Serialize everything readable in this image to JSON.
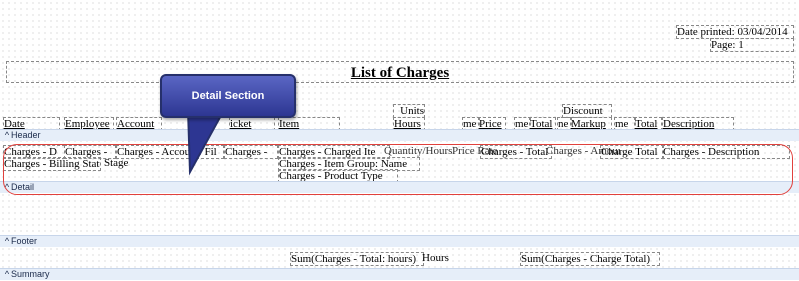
{
  "page_header": {
    "date_printed": "Date printed: 03/04/2014",
    "page": "Page: 1"
  },
  "report_title": "List of Charges",
  "column_headers": {
    "date": "Date",
    "employee": "Employee",
    "account": "Account",
    "ticket": "icket",
    "item": "Item",
    "units_top": "Units",
    "units_hours": "Hours",
    "price_prefix": "me",
    "price": "Price",
    "total_prefix": "me",
    "total": "Total",
    "discount_top": "Discount",
    "markup_prefix": "ne",
    "markup": "Markup",
    "charge_total_prefix": "me",
    "charge_total": "Total",
    "description": "Description"
  },
  "bands": {
    "header": "Header",
    "detail": "Detail",
    "footer": "Footer",
    "summary": "Summary"
  },
  "detail_fields": {
    "date": "Charges - D",
    "employee": "Charges - ",
    "account": "Charges - Account: Fil",
    "ticket": "Charges - ",
    "item_id": "Charges - Charged Ite",
    "quantity_overlap": "Quantity/Hours",
    "price_overlap": "Price Rate",
    "total": "Charges - Total",
    "discount_overlap": "Charges - Amount",
    "charge_total": "Charge Total",
    "description": "Charges - Description",
    "billing_status": "Charges - Billing Status",
    "stage": "Stage",
    "item_group": "Charges - Item Group: Name",
    "product_type": "Charges - Product Type"
  },
  "footer_fields": {
    "sum_hours": "Sum(Charges - Total: hours)",
    "hours_label": "Hours",
    "sum_charge_total": "Sum(Charges - Charge Total)"
  },
  "callout": {
    "label": "Detail Section"
  },
  "colors": {
    "band_background": "#e6eef9",
    "highlight_outline": "#e1413d",
    "callout_fill": "#2d3692"
  }
}
